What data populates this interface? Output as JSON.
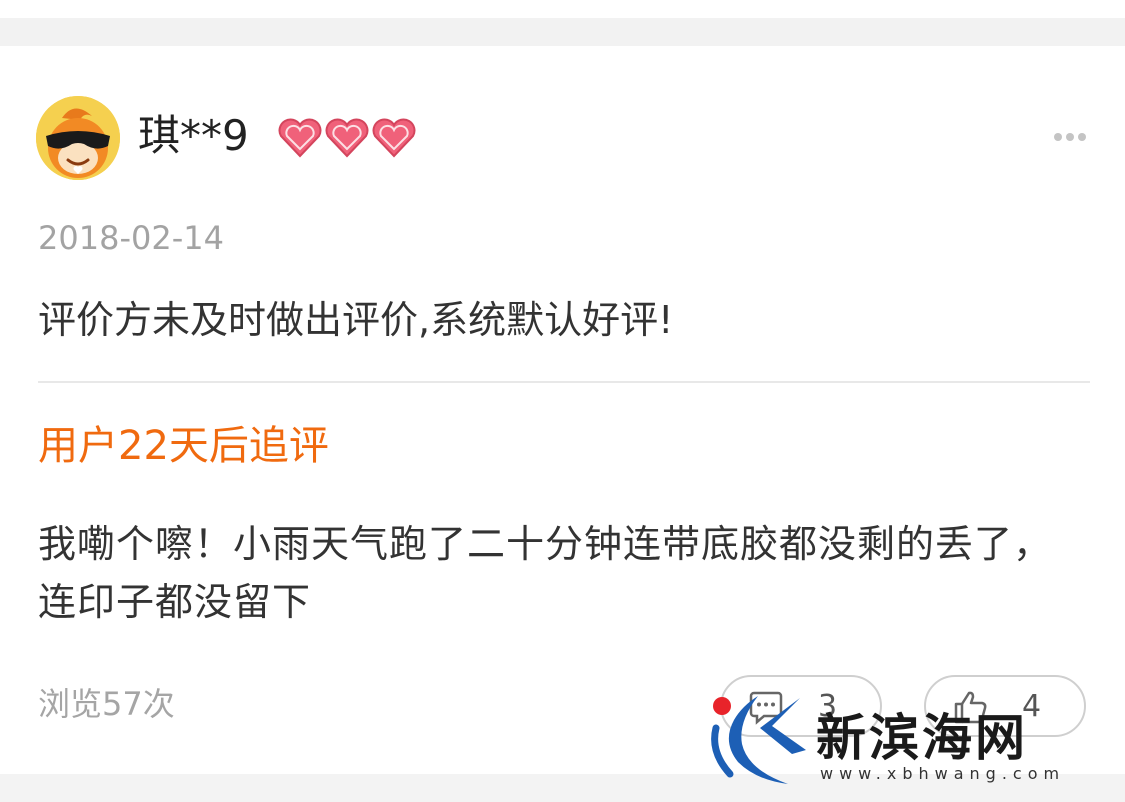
{
  "review": {
    "username": "琪**9",
    "rating_hearts": 3,
    "date": "2018-02-14",
    "text": "评价方未及时做出评价,系统默认好评!"
  },
  "followup": {
    "title": "用户22天后追评",
    "text": "我嘞个嚓！小雨天气跑了二十分钟连带底胶都没剩的丢了，连印子都没留下"
  },
  "footer": {
    "views": "浏览57次",
    "comment_count": "3",
    "like_count": "4"
  },
  "icons": {
    "more": "more-dots-icon",
    "comment": "comment-bubble-icon",
    "like": "thumbs-up-icon"
  },
  "watermark": {
    "name": "新滨海网",
    "url": "www.xbhwang.com"
  },
  "colors": {
    "accent_orange": "#f06a0f",
    "heart_pink": "#f0617a",
    "avatar_yellow": "#f5d04f",
    "muted_gray": "#a3a3a3"
  }
}
